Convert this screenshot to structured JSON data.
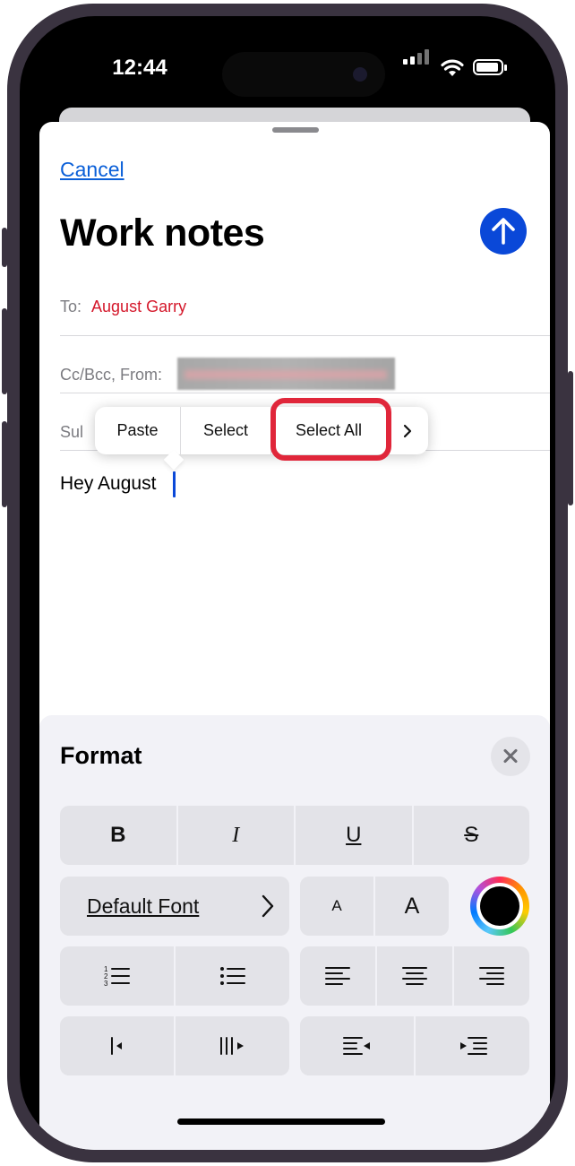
{
  "status": {
    "time": "12:44"
  },
  "compose": {
    "cancel_label": "Cancel",
    "title": "Work notes",
    "to_label": "To:",
    "to_value": "August Garry",
    "ccbcc_label": "Cc/Bcc, From:",
    "subject_label_partial": "Sul",
    "body_text": "Hey August"
  },
  "edit_menu": {
    "items": [
      "Paste",
      "Select",
      "Select All"
    ],
    "more_icon": "chevron-right-icon",
    "highlight_color": "#e0263a"
  },
  "format": {
    "title": "Format",
    "bold": "B",
    "italic": "I",
    "underline": "U",
    "strikethrough": "S",
    "font_name": "Default Font",
    "size_small": "A",
    "size_large": "A",
    "text_color": "#000000"
  },
  "colors": {
    "accent": "#0a48d8",
    "link": "#0a5fd8",
    "recipient": "#d4172a"
  }
}
